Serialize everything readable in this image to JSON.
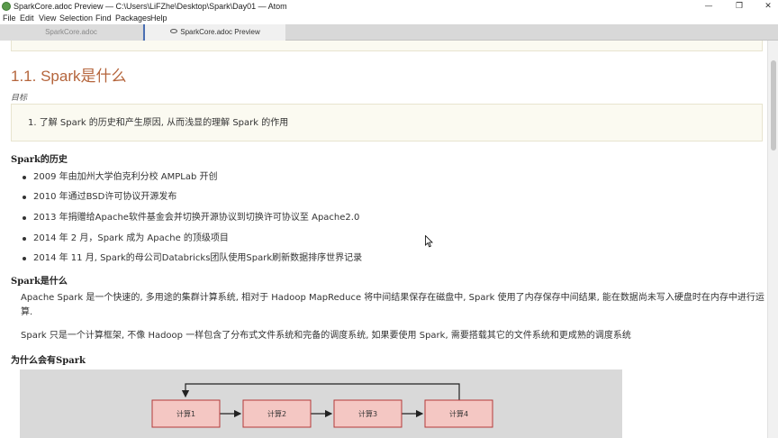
{
  "window": {
    "title": "SparkCore.adoc Preview — C:\\Users\\LiFZhe\\Desktop\\Spark\\Day01 — Atom",
    "app_icon": "atom-icon",
    "controls": {
      "minimize": "—",
      "maximize": "❐",
      "close": "✕"
    }
  },
  "menu": [
    "File",
    "Edit",
    "View",
    "Selection",
    "Find",
    "Packages",
    "Help"
  ],
  "tabs": [
    {
      "label": "SparkCore.adoc",
      "active": false
    },
    {
      "label": "SparkCore.adoc Preview",
      "active": true,
      "icon": "eye-icon"
    }
  ],
  "doc": {
    "section_title": "1.1. Spark是什么",
    "goal_label": "目标",
    "goal_item": "1. 了解 Spark 的历史和产生原因, 从而浅显的理解 Spark 的作用",
    "history_heading": "Spark的历史",
    "history_items": [
      "2009 年由加州大学伯克利分校 AMPLab 开创",
      "2010 年通过BSD许可协议开源发布",
      "2013 年捐赠给Apache软件基金会并切换开源协议到切换许可协议至 Apache2.0",
      "2014 年 2 月，Spark 成为 Apache 的顶级项目",
      "2014 年 11 月, Spark的母公司Databricks团队使用Spark刷新数据排序世界记录"
    ],
    "what_heading": "Spark是什么",
    "what_para1_line1": "Apache Spark 是一个快速的, 多用途的集群计算系统, 相对于 Hadoop MapReduce 将中间结果保存在磁盘中, Spark 使用了内存保存中间结果, 能在数据尚未写入硬盘时在内存中进行运",
    "what_para1_line2": "算.",
    "what_para2": "Spark 只是一个计算框架, 不像 Hadoop 一样包含了分布式文件系统和完备的调度系统, 如果要使用 Spark, 需要搭载其它的文件系统和更成熟的调度系统",
    "why_heading": "为什么会有Spark",
    "diagram_nodes": [
      "计算1",
      "计算2",
      "计算3",
      "计算4"
    ]
  },
  "colors": {
    "section_title": "#b5653c",
    "note_box_bg": "#fbfaf1",
    "diagram_bg": "#d9d9d9",
    "node_fill": "#f4c7c3",
    "node_stroke": "#b33a3a"
  }
}
